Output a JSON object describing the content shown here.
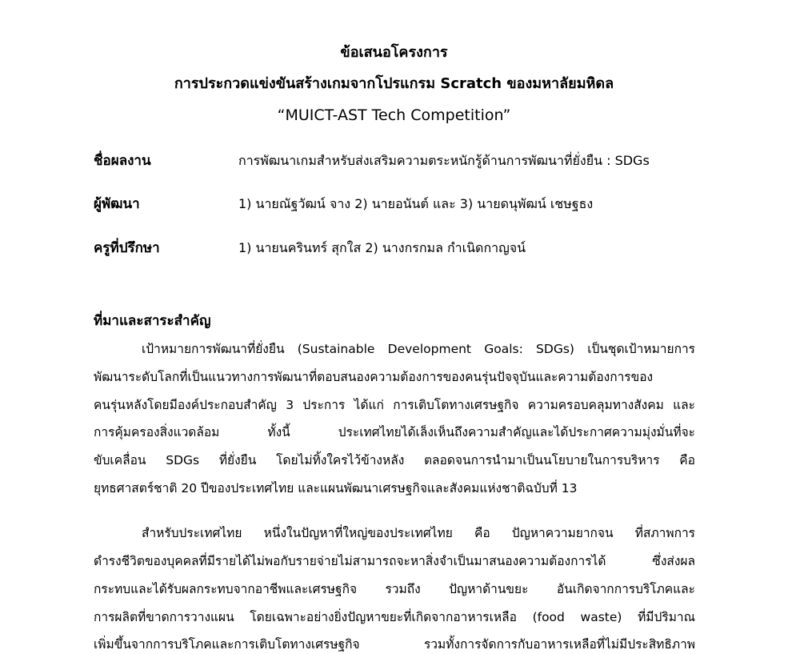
{
  "document": {
    "title_lines": [
      "ข้อเสนอโครงการ",
      "การประกวดแข่งขันสร้างเกมจากโปรแกรม Scratch ของมหาลัยมหิดล",
      "“MUICT-AST Tech Competition”"
    ],
    "info": [
      {
        "label": "ชื่อผลงาน",
        "value": "การพัฒนาเกมสำหรับส่งเสริมความตระหนักรู้ด้านการพัฒนาที่ยั่งยืน : SDGs"
      },
      {
        "label": "ผู้พัฒนา",
        "value": "1) นายณัฐวัฒน์ จาง 2) นายอนันต์ และ 3) นายดนุพัฒน์ เชษฐธง"
      },
      {
        "label": "ครูที่ปรึกษา",
        "value": "1) นายนครินทร์ สุกใส 2) นางกรกมล กำเนิดกาญจน์"
      }
    ],
    "section_heading": "ที่มาและสาระสำคัญ",
    "paragraph1": [
      "เป้าหมายการพัฒนาที่ยั่งยืน (Sustainable Development Goals: SDGs) เป็นชุดเป้าหมายการ",
      "พัฒนาระดับโลกที่เป็นแนวทางการพัฒนาที่ตอบสนองความต้องการของคนรุ่นปัจจุบันและความต้องการของ",
      "คนรุ่นหลังโดยมีองค์ประกอบสำคัญ 3 ประการ ได้แก่ การเติบโตทางเศรษฐกิจ ความครอบคลุมทางสังคม และ",
      "การคุ้มครองสิ่งแวดล้อม ทั้งนี้ ประเทศไทยได้เล็งเห็นถึงความสำคัญและได้ประกาศความมุ่งมั่นที่จะ",
      "ขับเคลื่อน SDGs ที่ยั่งยืน โดยไม่ทิ้งใครไว้ข้างหลัง ตลอดจนการนำมาเป็นนโยบายในการบริหาร คือ",
      "ยุทธศาสตร์ชาติ 20 ปีของประเทศไทย และแผนพัฒนาเศรษฐกิจและสังคมแห่งชาติฉบับที่ 13"
    ],
    "paragraph2": [
      "สำหรับประเทศไทย หนึ่งในปัญหาที่ใหญ่ของประเทศไทย คือ ปัญหาความยากจน ที่สภาพการ",
      "ดำรงชีวิตของบุคคลที่มีรายได้ไม่พอกับรายจ่ายไม่สามารถจะหาสิ่งจำเป็นมาสนองความต้องการได้ ซึ่งส่งผล",
      "กระทบและได้รับผลกระทบจากอาชีพและเศรษฐกิจ รวมถึง ปัญหาด้านขยะ อันเกิดจากการบริโภคและ",
      "การผลิตที่ขาดการวางแผน โดยเฉพาะอย่างยิ่งปัญหาขยะที่เกิดจากอาหารเหลือ (food waste) ที่มีปริมาณ",
      "เพิ่มขึ้นจากการบริโภคและการเติบโตทางเศรษฐกิจ รวมทั้งการจัดการกับอาหารเหลือที่ไม่มีประสิทธิภาพ"
    ]
  }
}
